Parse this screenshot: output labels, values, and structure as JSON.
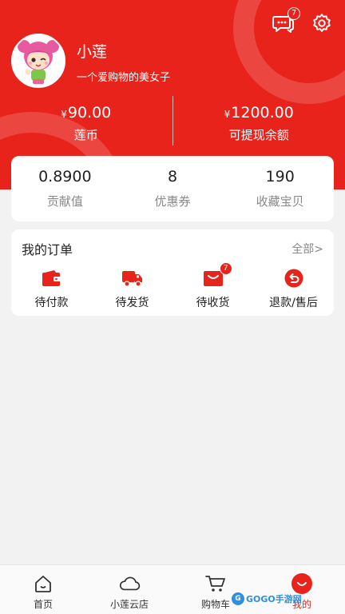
{
  "header": {
    "message_badge": "7",
    "user_name": "小莲",
    "user_signature": "一个爱购物的美女子"
  },
  "wallet": [
    {
      "currency": "¥",
      "amount": "90.00",
      "label": "莲币"
    },
    {
      "currency": "¥",
      "amount": "1200.00",
      "label": "可提现余额"
    }
  ],
  "stats": [
    {
      "value": "0.8900",
      "label": "贡献值"
    },
    {
      "value": "8",
      "label": "优惠券"
    },
    {
      "value": "190",
      "label": "收藏宝贝"
    }
  ],
  "orders": {
    "title": "我的订单",
    "view_all": "全部>",
    "items": [
      {
        "label": "待付款",
        "icon": "wallet-icon"
      },
      {
        "label": "待发货",
        "icon": "truck-icon"
      },
      {
        "label": "待收货",
        "icon": "package-icon",
        "badge": "7"
      },
      {
        "label": "退款/售后",
        "icon": "refund-icon"
      }
    ]
  },
  "tabbar": [
    {
      "label": "首页",
      "icon": "home-icon"
    },
    {
      "label": "小莲云店",
      "icon": "cloud-icon"
    },
    {
      "label": "购物车",
      "icon": "cart-icon"
    },
    {
      "label": "我的",
      "icon": "mine-icon",
      "active": true
    }
  ],
  "watermark": {
    "text": "GOGO手游网"
  },
  "colors": {
    "brand": "#e8231b",
    "background": "#f2f2f2"
  }
}
